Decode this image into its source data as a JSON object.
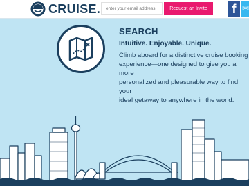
{
  "header": {
    "logo_text": "CRUISE.ME",
    "email_placeholder": "enter your email address",
    "invite_label": "Request an Invite",
    "facebook_glyph": "f",
    "twitter_glyph": "✉"
  },
  "section": {
    "title": "SEARCH",
    "tagline": "Intuitive. Enjoyable. Unique.",
    "body_lines": [
      "Climb aboard for a distinctive cruise booking",
      "experience—one designed to give you a more",
      "personalized and pleasurable way to find your",
      "ideal getaway to anywhere in the world."
    ]
  },
  "icons": {
    "logo": "life-ring-icon",
    "search": "folded-map-icon"
  },
  "colors": {
    "background": "#bfe4f3",
    "navy": "#1b3f5e",
    "accent": "#e9196e",
    "facebook": "#2e5598",
    "twitter": "#38b8f0"
  }
}
